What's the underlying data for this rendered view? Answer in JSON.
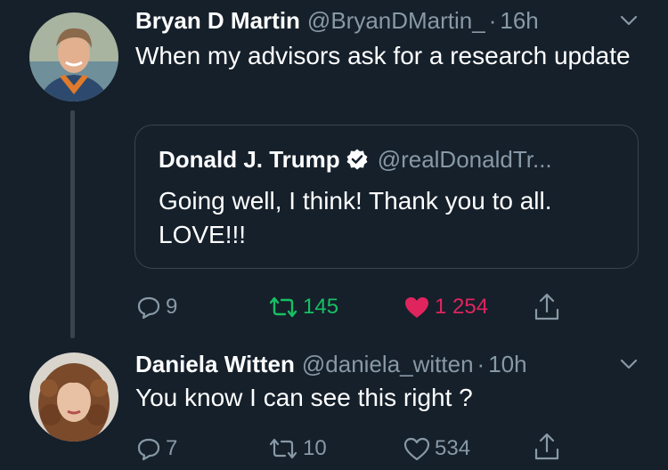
{
  "tweets": [
    {
      "name": "Bryan D Martin",
      "handle": "@BryanDMartin_",
      "dot": "·",
      "time": "16h",
      "text": "When my advisors ask for a research update",
      "quote": {
        "name": "Donald J. Trump",
        "handle": "@realDonaldTr...",
        "text": "Going well, I think! Thank you to all. LOVE!!!"
      },
      "replies": "9",
      "retweets": "145",
      "likes": "1 254",
      "liked": true
    },
    {
      "name": "Daniela Witten",
      "handle": "@daniela_witten",
      "dot": "·",
      "time": "10h",
      "text": "You know I can see this right ?",
      "replies": "7",
      "retweets": "10",
      "likes": "534",
      "liked": false
    }
  ],
  "colors": {
    "background": "#15202b",
    "muted": "#8899a6",
    "retweet_active": "#17bf63",
    "like_active": "#e0245e",
    "verified": "#ffffff"
  },
  "icons": [
    "reply-icon",
    "retweet-icon",
    "like-icon",
    "share-icon",
    "chevron-down-icon",
    "verified-badge-icon"
  ]
}
